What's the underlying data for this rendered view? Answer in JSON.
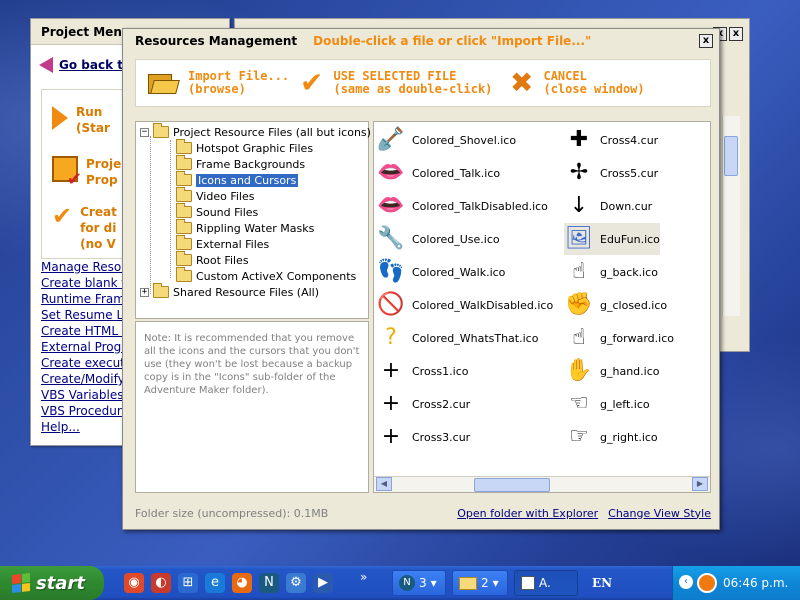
{
  "project_menu": {
    "title": "Project Men",
    "back_link": "Go back to",
    "actions": [
      {
        "line1": "Run",
        "line2": "(Star"
      },
      {
        "line1": "Proje",
        "line2": "Prop"
      },
      {
        "line1": "Creat",
        "line2": "for di",
        "line3": "(no V"
      }
    ],
    "links": [
      "Manage Resour",
      "Create blank f",
      "Runtime Fram",
      "Set Resume L",
      "Create HTML (",
      "External Progr",
      "Create execut",
      "Create/Modify",
      "VBS Variables",
      "VBS Procedur",
      "Help..."
    ]
  },
  "background_window": {
    "close_label": "x",
    "close2_label": "x"
  },
  "dialog": {
    "title": "Resources Management",
    "hint": "Double-click a file or click \"Import File...\"",
    "close_label": "x",
    "toolbar": {
      "import": {
        "line1": "Import File...",
        "line2": "(browse)",
        "icon": "open-folder-icon"
      },
      "use": {
        "line1": "USE SELECTED FILE",
        "line2": "(same as double-click)",
        "icon": "checkmark-icon"
      },
      "cancel": {
        "line1": "CANCEL",
        "line2": "(close window)",
        "icon": "x-icon"
      }
    },
    "tree": [
      {
        "label": "Project Resource Files (all but icons)",
        "expander": "−",
        "level": 0
      },
      {
        "label": "Hotspot Graphic Files",
        "level": 1
      },
      {
        "label": "Frame Backgrounds",
        "level": 1
      },
      {
        "label": "Icons and Cursors",
        "level": 1,
        "selected": true
      },
      {
        "label": "Video Files",
        "level": 1
      },
      {
        "label": "Sound Files",
        "level": 1
      },
      {
        "label": "Rippling Water Masks",
        "level": 1
      },
      {
        "label": "External Files",
        "level": 1
      },
      {
        "label": "Root Files",
        "level": 1
      },
      {
        "label": "Custom ActiveX Components",
        "level": 1
      },
      {
        "label": "Shared Resource Files (All)",
        "expander": "+",
        "level": 0
      }
    ],
    "note": "Note: It is recommended that you remove all the icons and the cursors that you don't use (they won't be lost because a backup copy is in the \"Icons\" sub-folder of the Adventure Maker folder).",
    "files_col1": [
      {
        "name": "Colored_Shovel.ico",
        "glyph": "🪏",
        "color": "#8a4a1a"
      },
      {
        "name": "Colored_Talk.ico",
        "glyph": "👄",
        "color": "#d02020"
      },
      {
        "name": "Colored_TalkDisabled.ico",
        "glyph": "👄",
        "color": "#7a6a6a"
      },
      {
        "name": "Colored_Use.ico",
        "glyph": "🔧",
        "color": "#3a8ab0"
      },
      {
        "name": "Colored_Walk.ico",
        "glyph": "👣",
        "color": "#e8a0b0"
      },
      {
        "name": "Colored_WalkDisabled.ico",
        "glyph": "🚫",
        "color": "#d02020"
      },
      {
        "name": "Colored_WhatsThat.ico",
        "glyph": "?",
        "color": "#e8b000"
      },
      {
        "name": "Cross1.ico",
        "glyph": "+",
        "color": "#000000"
      },
      {
        "name": "Cross2.cur",
        "glyph": "+",
        "color": "#000000"
      },
      {
        "name": "Cross3.cur",
        "glyph": "+",
        "color": "#000000"
      }
    ],
    "files_col2": [
      {
        "name": "Cross4.cur",
        "glyph": "✚",
        "color": "#000000"
      },
      {
        "name": "Cross5.cur",
        "glyph": "✢",
        "color": "#000000"
      },
      {
        "name": "Down.cur",
        "glyph": "↓",
        "color": "#000000"
      },
      {
        "name": "EduFun.ico",
        "glyph": "🖼",
        "color": "#3a6ad0",
        "selected": true
      },
      {
        "name": "g_back.ico",
        "glyph": "☝",
        "color": "#000000"
      },
      {
        "name": "g_closed.ico",
        "glyph": "✊",
        "color": "#000000"
      },
      {
        "name": "g_forward.ico",
        "glyph": "☝",
        "color": "#000000"
      },
      {
        "name": "g_hand.ico",
        "glyph": "✋",
        "color": "#000000"
      },
      {
        "name": "g_left.ico",
        "glyph": "☜",
        "color": "#000000"
      },
      {
        "name": "g_right.ico",
        "glyph": "☞",
        "color": "#000000"
      }
    ],
    "footer": {
      "folder_size": "Folder size (uncompressed): 0.1MB",
      "open_folder": "Open folder with Explorer",
      "change_view": "Change View Style"
    }
  },
  "taskbar": {
    "start_label": "start",
    "quick_launch": [
      {
        "icon": "chrome-icon",
        "glyph": "◉",
        "color": "#e04a2a"
      },
      {
        "icon": "media-icon",
        "glyph": "◐",
        "color": "#c83a2a"
      },
      {
        "icon": "explorer-icon",
        "glyph": "⊞",
        "color": "#2a6ad0"
      },
      {
        "icon": "ie-icon",
        "glyph": "e",
        "color": "#1a7ad8"
      },
      {
        "icon": "firefox-icon",
        "glyph": "◕",
        "color": "#e86a10"
      },
      {
        "icon": "netscape-icon",
        "glyph": "N",
        "color": "#1a5a80"
      },
      {
        "icon": "tool-icon",
        "glyph": "⚙",
        "color": "#3a7ad0"
      },
      {
        "icon": "player-icon",
        "glyph": "▶",
        "color": "#2a5ab0"
      }
    ],
    "overflow": "»",
    "tasks": [
      {
        "label": "3",
        "icon": "netscape-icon"
      },
      {
        "label": "2",
        "icon": "folder-icon"
      },
      {
        "label": "A.",
        "icon": "app-icon"
      }
    ],
    "language": "EN",
    "time": "06:46 p.m."
  }
}
